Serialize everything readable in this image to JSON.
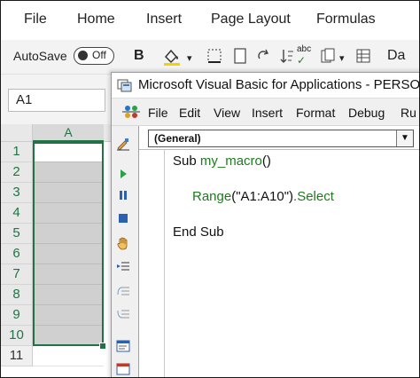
{
  "excel": {
    "tabs": [
      "File",
      "Home",
      "Insert",
      "Page Layout",
      "Formulas"
    ],
    "autosave": {
      "label": "AutoSave",
      "state": "Off"
    },
    "toolbar_bold": "B",
    "toolbar_abc": "abc",
    "toolbar_truncated": "Da",
    "name_box": "A1",
    "column_header": "A",
    "rows": [
      "1",
      "2",
      "3",
      "4",
      "5",
      "6",
      "7",
      "8",
      "9",
      "10",
      "11"
    ],
    "selection_color": "#217346"
  },
  "vba": {
    "title": "Microsoft Visual Basic for Applications - PERSONAL",
    "menu": [
      "File",
      "Edit",
      "View",
      "Insert",
      "Format",
      "Debug",
      "Ru"
    ],
    "procedure_combo": "(General)",
    "code": {
      "line1_kw": "Sub ",
      "line1_name": "my_macro",
      "line1_end": "()",
      "line2_range": "Range",
      "line2_args": "(\"A1:A10\")",
      "line2_select": ".Select",
      "line3": "End Sub"
    }
  }
}
